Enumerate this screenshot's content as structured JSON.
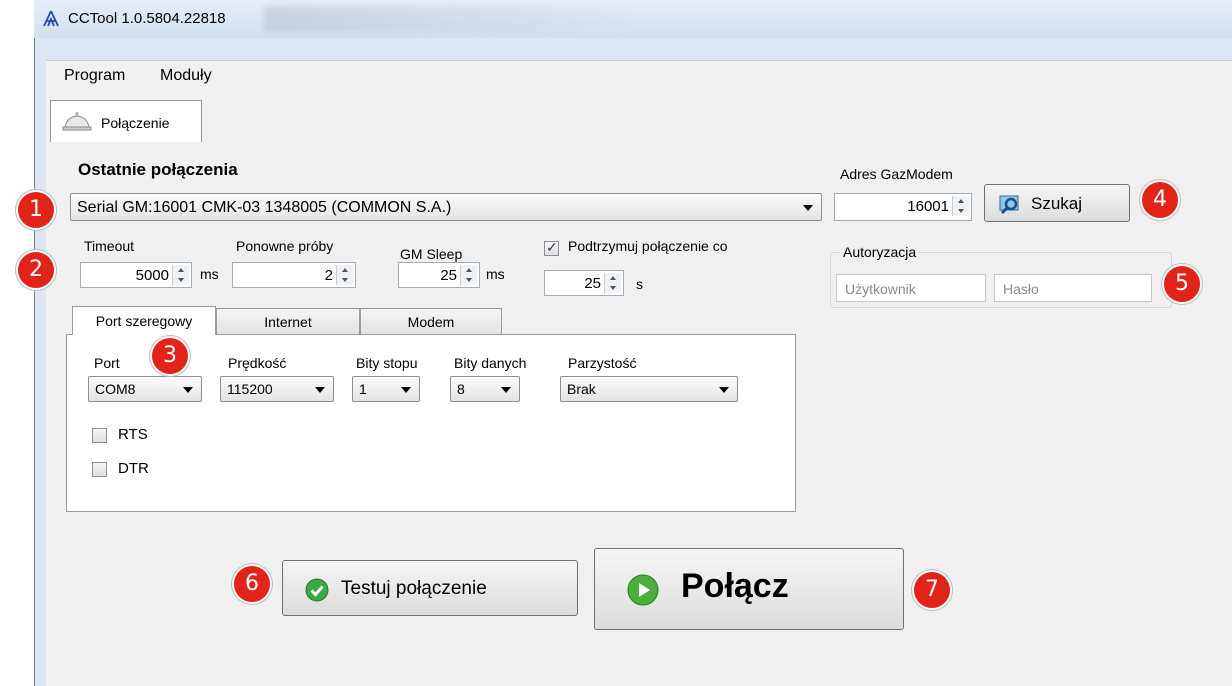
{
  "window": {
    "title": "CCTool 1.0.5804.22818"
  },
  "menu": {
    "items": [
      "Program",
      "Moduły"
    ]
  },
  "doc_tab": {
    "label": "Połączenie"
  },
  "recent": {
    "heading": "Ostatnie połączenia",
    "selected": "Serial GM:16001 CMK-03 1348005 (COMMON S.A.)"
  },
  "gazmodem": {
    "label": "Adres GazModem",
    "value": "16001",
    "search_label": "Szukaj"
  },
  "timeout": {
    "label": "Timeout",
    "value": "5000",
    "unit": "ms"
  },
  "retries": {
    "label": "Ponowne próby",
    "value": "2"
  },
  "gmsleep": {
    "label": "GM Sleep",
    "value": "25",
    "unit": "ms"
  },
  "keepalive": {
    "label": "Podtrzymuj połączenie co",
    "checked": true,
    "value": "25",
    "unit": "s"
  },
  "auth": {
    "legend": "Autoryzacja",
    "user_placeholder": "Użytkownik",
    "pass_placeholder": "Hasło"
  },
  "port_tabs": [
    "Port szeregowy",
    "Internet",
    "Modem"
  ],
  "serial": {
    "port_label": "Port",
    "port_value": "COM8",
    "speed_label": "Prędkość",
    "speed_value": "115200",
    "stop_label": "Bity stopu",
    "stop_value": "1",
    "data_label": "Bity danych",
    "data_value": "8",
    "parity_label": "Parzystość",
    "parity_value": "Brak",
    "rts_label": "RTS",
    "dtr_label": "DTR"
  },
  "actions": {
    "test_label": "Testuj połączenie",
    "connect_label": "Połącz"
  },
  "badges": [
    "1",
    "2",
    "3",
    "4",
    "5",
    "6",
    "7"
  ],
  "colors": {
    "badge": "#e2231a",
    "window_frame": "#dce7f3",
    "panel": "#f0f0f0"
  }
}
